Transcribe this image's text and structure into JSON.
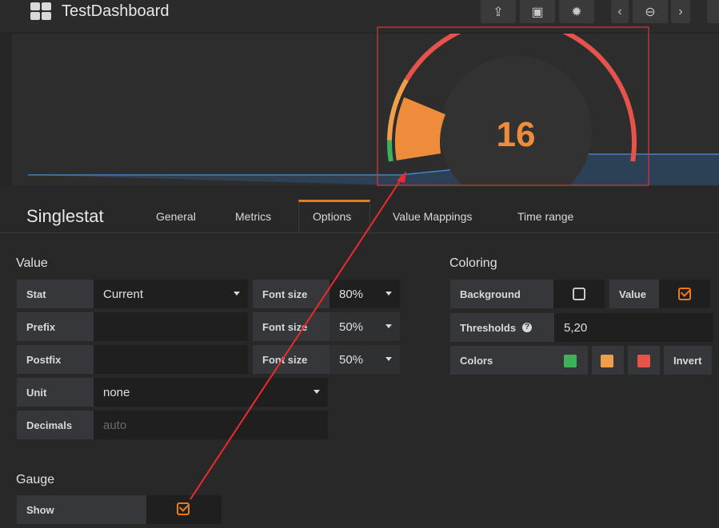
{
  "header": {
    "title": "TestDashboard",
    "buttons": [
      {
        "icon": "share-icon"
      },
      {
        "icon": "save-icon"
      },
      {
        "icon": "gear-icon"
      },
      {
        "icon": "chevron-left-icon"
      },
      {
        "icon": "zoom-out-icon"
      },
      {
        "icon": "chevron-right-icon"
      }
    ]
  },
  "gauge": {
    "value": "16",
    "numeric": 16,
    "min": 0,
    "max": 100,
    "thresholds": [
      5,
      20
    ],
    "colors": [
      "#3eb15b",
      "#ef9f4a",
      "#e5534b"
    ],
    "value_color": "#ef8c3c",
    "series_color": "#4a8fd8"
  },
  "editor": {
    "title": "Singlestat",
    "tabs": [
      "General",
      "Metrics",
      "Options",
      "Value Mappings",
      "Time range"
    ],
    "active_tab": "Options"
  },
  "value": {
    "heading": "Value",
    "stat_label": "Stat",
    "stat": "Current",
    "prefix_label": "Prefix",
    "prefix": "",
    "postfix_label": "Postfix",
    "postfix": "",
    "font_size_label": "Font size",
    "font_size_value": "80%",
    "font_size_prefix": "50%",
    "font_size_postfix": "50%",
    "unit_label": "Unit",
    "unit": "none",
    "decimals_label": "Decimals",
    "decimals_placeholder": "auto"
  },
  "coloring": {
    "heading": "Coloring",
    "background_label": "Background",
    "background": false,
    "value_label": "Value",
    "value": true,
    "thresholds_label": "Thresholds",
    "thresholds": "5,20",
    "colors_label": "Colors",
    "invert_label": "Invert"
  },
  "gauge_section": {
    "heading": "Gauge",
    "show_label": "Show",
    "show": true
  }
}
